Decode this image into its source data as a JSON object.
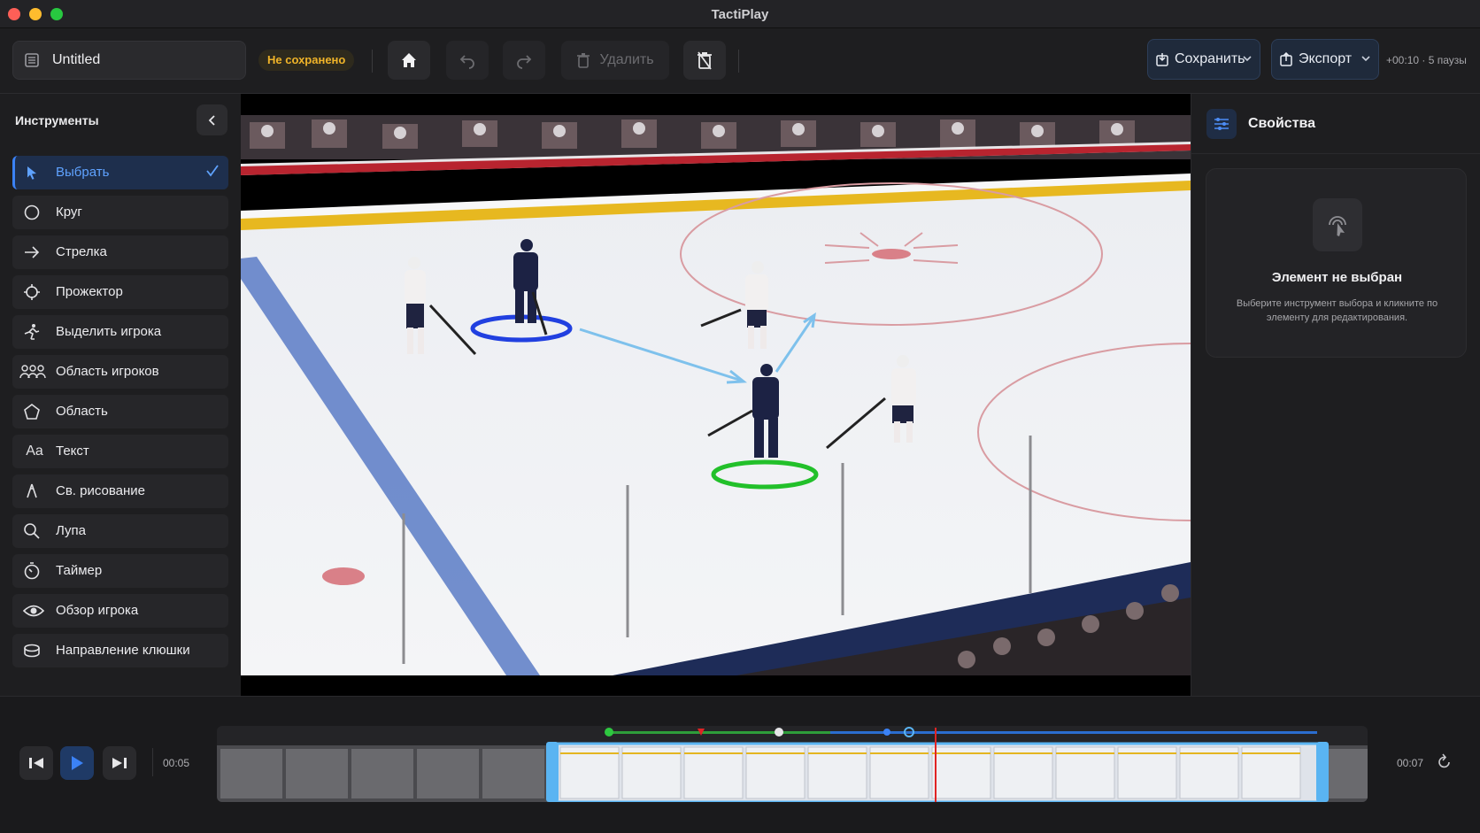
{
  "window": {
    "title": "TactiPlay"
  },
  "toolbar": {
    "project_name": "Untitled",
    "unsaved_badge": "Не сохранено",
    "delete_label": "Удалить",
    "save_label": "Сохранить",
    "export_label": "Экспорт",
    "time_info": "+00:10 · 5 паузы"
  },
  "sidebar": {
    "title": "Инструменты",
    "selected_tool": "Выбрать",
    "tools": [
      {
        "label": "Выбрать",
        "icon": "cursor-icon"
      },
      {
        "label": "Круг",
        "icon": "circle-icon"
      },
      {
        "label": "Стрелка",
        "icon": "arrow-icon"
      },
      {
        "label": "Прожектор",
        "icon": "spotlight-icon"
      },
      {
        "label": "Выделить игрока",
        "icon": "skater-icon"
      },
      {
        "label": "Область игроков",
        "icon": "group-icon"
      },
      {
        "label": "Область",
        "icon": "pentagon-icon"
      },
      {
        "label": "Текст",
        "icon": "text-icon",
        "glyph": "Aa"
      },
      {
        "label": "Св. рисование",
        "icon": "pen-icon"
      },
      {
        "label": "Лупа",
        "icon": "magnifier-icon"
      },
      {
        "label": "Таймер",
        "icon": "timer-icon"
      },
      {
        "label": "Обзор игрока",
        "icon": "eye-icon"
      },
      {
        "label": "Направление клюшки",
        "icon": "stick-direction-icon"
      }
    ]
  },
  "properties": {
    "title": "Свойства",
    "empty_title": "Элемент не выбран",
    "empty_desc": "Выберите инструмент выбора и кликните по элементу для редактирования."
  },
  "timeline": {
    "current_time": "00:05",
    "end_time": "00:07"
  },
  "colors": {
    "accent": "#3b82f6",
    "unsaved": "#f0b429",
    "highlight_blue": "#2140e0",
    "highlight_green": "#22c02a",
    "arrow": "#7ec1ec",
    "playhead": "#e02424"
  }
}
